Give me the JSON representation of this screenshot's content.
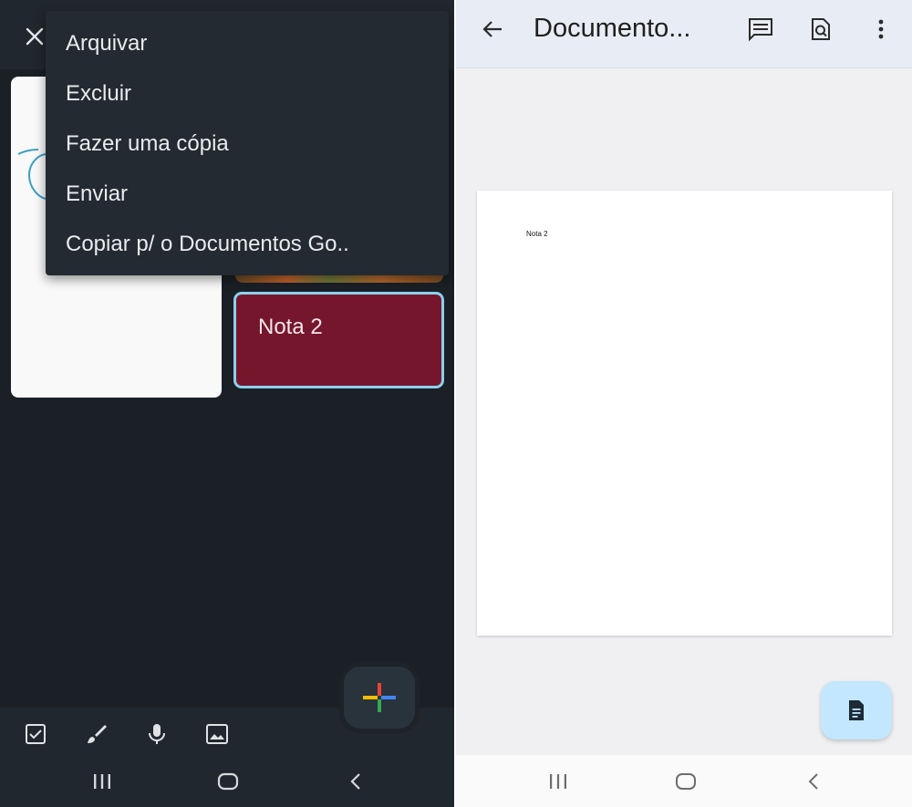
{
  "keep": {
    "menu": {
      "items": [
        {
          "label": "Arquivar"
        },
        {
          "label": "Excluir"
        },
        {
          "label": "Fazer uma cópia"
        },
        {
          "label": "Enviar"
        },
        {
          "label": "Copiar p/ o Documentos Go.."
        }
      ]
    },
    "notes": [
      {
        "title": "Nota 2",
        "color": "#76162d",
        "selected": true
      }
    ],
    "bottom_tools": [
      "checkbox-icon",
      "brush-icon",
      "mic-icon",
      "image-icon"
    ],
    "fab": "add-multicolor-icon"
  },
  "docs": {
    "title": "Documento...",
    "page_text": "Nota 2",
    "fab": "document-icon",
    "top_icons": [
      "comment-icon",
      "find-in-page-icon",
      "more-vert-icon"
    ]
  },
  "colors": {
    "keep_bg": "#1b2026",
    "keep_menu_bg": "#232a31",
    "note_red": "#76162d",
    "selected_outline": "#8bd0ec",
    "docs_topbar": "#e8edf5",
    "docs_fab": "#c2e7ff"
  }
}
